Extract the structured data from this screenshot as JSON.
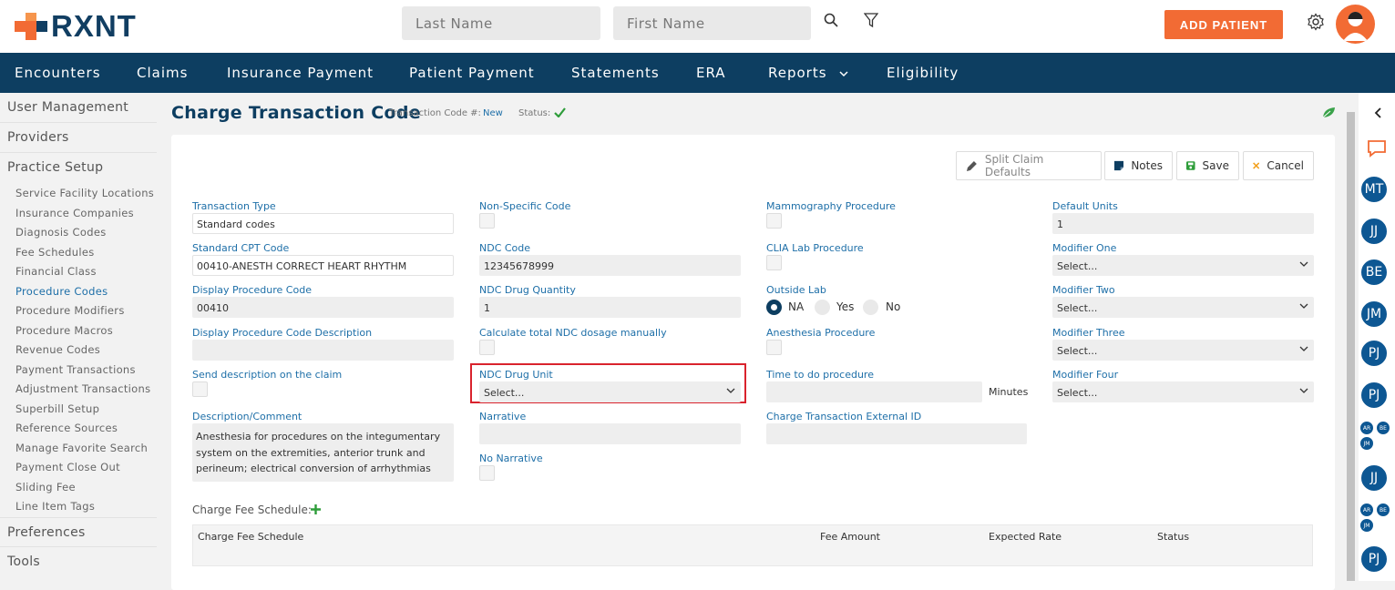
{
  "header": {
    "logo_text": "RXNT",
    "last_name_placeholder": "Last Name",
    "first_name_placeholder": "First Name",
    "add_patient_label": "ADD PATIENT"
  },
  "nav": {
    "items": [
      "Encounters",
      "Claims",
      "Insurance Payment",
      "Patient Payment",
      "Statements",
      "ERA",
      "Reports",
      "Eligibility"
    ]
  },
  "sidebar": {
    "top_items": [
      "User Management",
      "Providers",
      "Practice Setup"
    ],
    "sub_items": [
      "Service Facility Locations",
      "Insurance Companies",
      "Diagnosis Codes",
      "Fee Schedules",
      "Financial Class",
      "Procedure Codes",
      "Procedure Modifiers",
      "Procedure Macros",
      "Revenue Codes",
      "Payment Transactions",
      "Adjustment Transactions",
      "Superbill Setup",
      "Reference Sources",
      "Manage Favorite Search",
      "Payment Close Out",
      "Sliding Fee",
      "Line Item Tags"
    ],
    "active_sub": "Procedure Codes",
    "bottom_items": [
      "Preferences",
      "Tools"
    ]
  },
  "page": {
    "title": "Charge Transaction Code",
    "code_label": "Transaction Code #:",
    "code_value": "New",
    "status_label": "Status:"
  },
  "toolbar": {
    "split_label": "Split Claim Defaults",
    "notes_label": "Notes",
    "save_label": "Save",
    "cancel_label": "Cancel"
  },
  "form": {
    "transaction_type_label": "Transaction Type",
    "transaction_type_value": "Standard codes",
    "std_cpt_label": "Standard CPT Code",
    "std_cpt_value": "00410-ANESTH CORRECT HEART RHYTHM",
    "display_code_label": "Display Procedure Code",
    "display_code_value": "00410",
    "display_desc_label": "Display Procedure Code Description",
    "send_desc_label": "Send description on the claim",
    "desc_comment_label": "Description/Comment",
    "desc_comment_value": "Anesthesia for procedures on the integumentary system on the extremities, anterior trunk and perineum; electrical conversion of arrhythmias",
    "nonspecific_label": "Non-Specific Code",
    "ndc_code_label": "NDC Code",
    "ndc_code_value": "12345678999",
    "ndc_qty_label": "NDC Drug Quantity",
    "ndc_qty_value": "1",
    "calc_ndc_label": "Calculate total NDC dosage manually",
    "ndc_unit_label": "NDC Drug Unit",
    "ndc_unit_value": "Select...",
    "narrative_label": "Narrative",
    "no_narrative_label": "No Narrative",
    "mammo_label": "Mammography Procedure",
    "clia_label": "CLIA Lab Procedure",
    "outside_lab_label": "Outside Lab",
    "outside_lab_options": [
      "NA",
      "Yes",
      "No"
    ],
    "outside_lab_selected": "NA",
    "anesthesia_label": "Anesthesia Procedure",
    "time_label": "Time to do procedure",
    "minutes_label": "Minutes",
    "external_id_label": "Charge Transaction External ID",
    "default_units_label": "Default Units",
    "default_units_value": "1",
    "mod1_label": "Modifier One",
    "mod2_label": "Modifier Two",
    "mod3_label": "Modifier Three",
    "mod4_label": "Modifier Four",
    "select_placeholder": "Select..."
  },
  "fee_schedule": {
    "title": "Charge Fee Schedule:",
    "columns": [
      "Charge Fee Schedule",
      "Fee Amount",
      "Expected Rate",
      "Status"
    ]
  },
  "right_panel": {
    "avatars": [
      "MT",
      "JJ",
      "BE",
      "JM",
      "PJ",
      "PJ",
      "JJ",
      "PJ"
    ],
    "group1": [
      "AR",
      "BE",
      "JM"
    ],
    "group2": [
      "AR",
      "BE",
      "JM"
    ]
  },
  "colors": {
    "brand_orange": "#f26b34",
    "navy": "#0d3e61",
    "link_blue": "#1e6fa8",
    "highlight_red": "#d9232d"
  }
}
